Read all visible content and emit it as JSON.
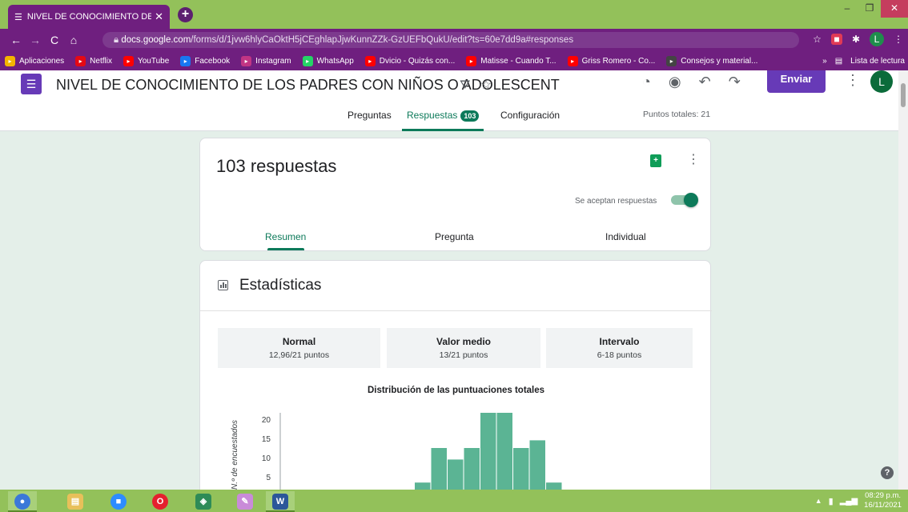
{
  "browser": {
    "tab_title": "NIVEL DE CONOCIMIENTO DE LC",
    "url_domain": "docs.google.com",
    "url_path": "/forms/d/1jvw6hlyCaOktH5jCEghlapJjwKunnZZk-GzUEFbQukU/edit?ts=60e7dd9a#responses",
    "profile_initial": "L",
    "bookmarks": [
      {
        "label": "Aplicaciones",
        "icon": "apps-grid-icon",
        "color": "#f4b400"
      },
      {
        "label": "Netflix",
        "icon": "netflix-icon",
        "color": "#e50914"
      },
      {
        "label": "YouTube",
        "icon": "youtube-icon",
        "color": "#ff0000"
      },
      {
        "label": "Facebook",
        "icon": "facebook-icon",
        "color": "#1877f2"
      },
      {
        "label": "Instagram",
        "icon": "instagram-icon",
        "color": "#c13584"
      },
      {
        "label": "WhatsApp",
        "icon": "whatsapp-icon",
        "color": "#25d366"
      },
      {
        "label": "Dvicio - Quizás con...",
        "icon": "youtube-icon",
        "color": "#ff0000"
      },
      {
        "label": "Matisse - Cuando T...",
        "icon": "youtube-icon",
        "color": "#ff0000"
      },
      {
        "label": "Griss Romero - Co...",
        "icon": "youtube-icon",
        "color": "#ff0000"
      },
      {
        "label": "Consejos y material...",
        "icon": "bookmark-icon",
        "color": "#444444"
      }
    ],
    "reading_list": "Lista de lectura"
  },
  "form": {
    "title": "NIVEL DE CONOCIMIENTO DE LOS PADRES CON NIÑOS O ADOLESCENT",
    "send_label": "Enviar",
    "avatar_initial": "L",
    "tabs": {
      "questions": "Preguntas",
      "responses": "Respuestas",
      "responses_count": "103",
      "settings": "Configuración"
    },
    "total_points": "Puntos totales: 21"
  },
  "responses_card": {
    "count_label": "103 respuestas",
    "accepting_label": "Se aceptan respuestas",
    "subtabs": {
      "summary": "Resumen",
      "question": "Pregunta",
      "individual": "Individual"
    }
  },
  "stats": {
    "title": "Estadísticas",
    "boxes": [
      {
        "label": "Normal",
        "value": "12,96/21 puntos"
      },
      {
        "label": "Valor medio",
        "value": "13/21 puntos"
      },
      {
        "label": "Intervalo",
        "value": "6-18 puntos"
      }
    ]
  },
  "chart_data": {
    "type": "bar",
    "title": "Distribución de las puntuaciones totales",
    "ylabel": "N.º de encuestados",
    "y_ticks": [
      "20",
      "15",
      "10",
      "5"
    ],
    "ylim": [
      0,
      22
    ],
    "bar_color": "#5bb494",
    "values": [
      1,
      10,
      7,
      10,
      20,
      20,
      10,
      12,
      1
    ]
  },
  "taskbar": {
    "time": "08:29 p.m.",
    "date": "16/11/2021"
  }
}
